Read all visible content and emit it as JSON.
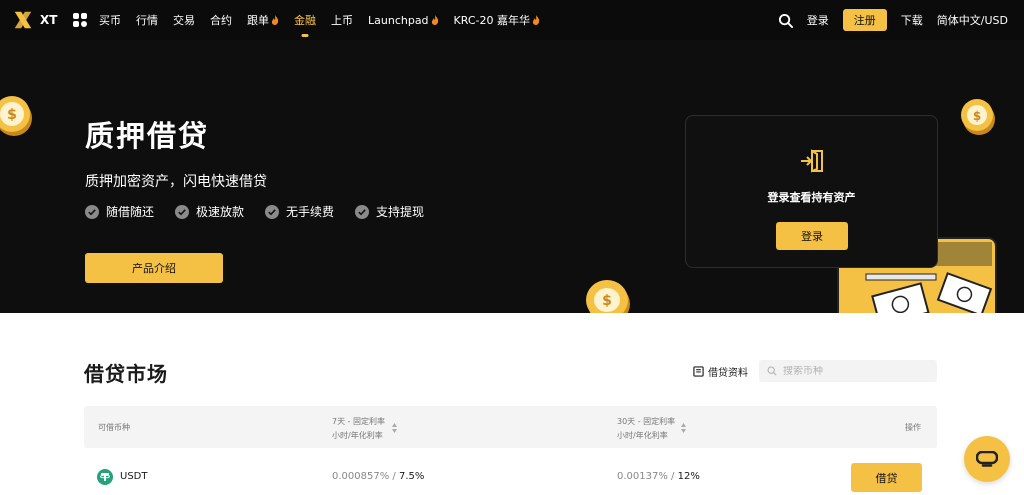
{
  "nav": {
    "brand": "XT",
    "menu": [
      {
        "label": "买币",
        "hot": false,
        "active": false
      },
      {
        "label": "行情",
        "hot": false,
        "active": false
      },
      {
        "label": "交易",
        "hot": false,
        "active": false
      },
      {
        "label": "合约",
        "hot": false,
        "active": false
      },
      {
        "label": "跟单",
        "hot": true,
        "active": false
      },
      {
        "label": "金融",
        "hot": false,
        "active": true
      },
      {
        "label": "上币",
        "hot": false,
        "active": false
      },
      {
        "label": "Launchpad",
        "hot": true,
        "active": false
      },
      {
        "label": "KRC-20 嘉年华",
        "hot": true,
        "active": false
      }
    ],
    "login": "登录",
    "register": "注册",
    "download": "下载",
    "language": "简体中文/USD"
  },
  "hero": {
    "title": "质押借贷",
    "subtitle": "质押加密资产，闪电快速借贷",
    "features": [
      "随借随还",
      "极速放款",
      "无手续费",
      "支持提现"
    ],
    "intro_button": "产品介绍"
  },
  "login_card": {
    "title": "登录查看持有资产",
    "button": "登录"
  },
  "market": {
    "title": "借贷市场",
    "docs_link": "借贷资料",
    "search_placeholder": "搜索币种",
    "columns": {
      "asset": "可借币种",
      "rate7": "7天 - 固定利率",
      "rate7_sub": "小时/年化利率",
      "rate30": "30天 - 固定利率",
      "rate30_sub": "小时/年化利率",
      "action": "操作"
    },
    "rows": [
      {
        "symbol": "USDT",
        "rate7_hour": "0.000857%",
        "rate7_year": "7.5%",
        "rate30_hour": "0.00137%",
        "rate30_year": "12%",
        "button": "借贷"
      }
    ]
  },
  "colors": {
    "accent": "#f5c144",
    "dark": "#0e0e0e"
  },
  "icons": [
    "logo-x-icon",
    "apps-grid-icon",
    "flame-icon",
    "search-icon",
    "check-circle-icon",
    "login-door-icon",
    "document-icon",
    "tether-icon",
    "chat-icon"
  ]
}
